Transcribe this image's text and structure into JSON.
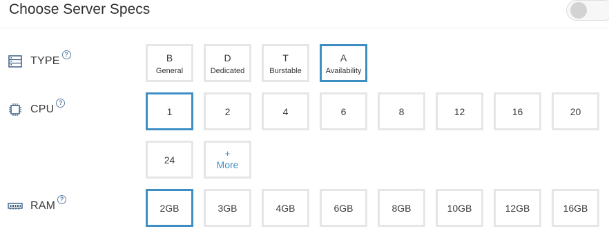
{
  "header": {
    "title": "Choose Server Specs"
  },
  "type_row": {
    "label": "TYPE",
    "help": "?",
    "options": [
      {
        "letter": "B",
        "name": "General"
      },
      {
        "letter": "D",
        "name": "Dedicated"
      },
      {
        "letter": "T",
        "name": "Burstable"
      },
      {
        "letter": "A",
        "name": "Availability"
      }
    ],
    "selected": "A"
  },
  "cpu_row": {
    "label": "CPU",
    "help": "?",
    "options": [
      "1",
      "2",
      "4",
      "6",
      "8",
      "12",
      "16",
      "20",
      "24"
    ],
    "selected": "1",
    "more": {
      "plus": "+",
      "label": "More"
    }
  },
  "ram_row": {
    "label": "RAM",
    "help": "?",
    "options": [
      "2GB",
      "3GB",
      "4GB",
      "6GB",
      "8GB",
      "10GB",
      "12GB",
      "16GB"
    ],
    "selected": "2GB"
  },
  "colors": {
    "accent": "#3e8ec4",
    "border": "#e6e6e6",
    "text": "#333333"
  },
  "icons": {
    "type": "server-icon",
    "cpu": "cpu-chip-icon",
    "ram": "memory-icon",
    "help": "help-circle-icon"
  }
}
